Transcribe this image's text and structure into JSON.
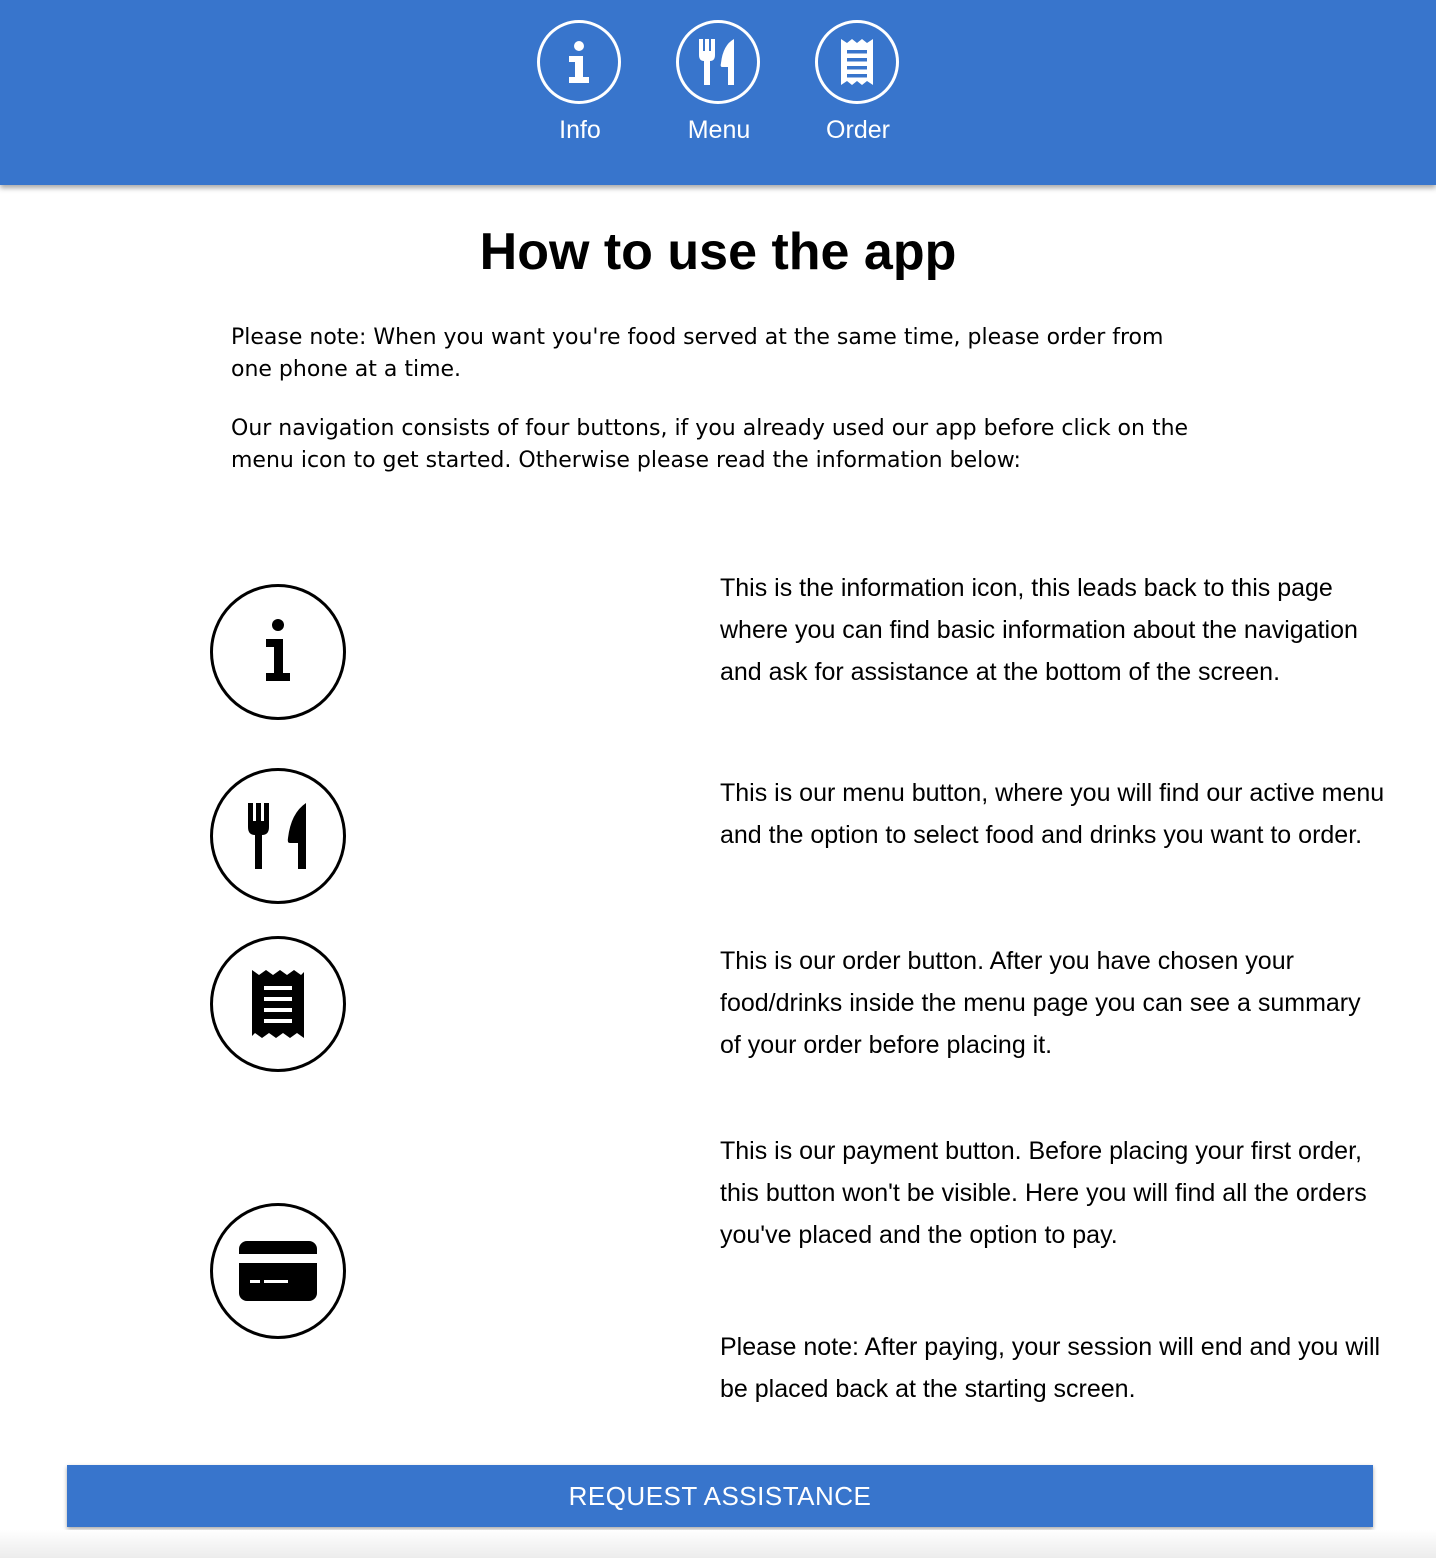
{
  "nav": {
    "items": [
      {
        "label": "Info",
        "icon": "info-icon"
      },
      {
        "label": "Menu",
        "icon": "utensils-icon"
      },
      {
        "label": "Order",
        "icon": "receipt-icon"
      }
    ]
  },
  "main": {
    "title": "How to use the app",
    "note": "Please note: When you want you're food served at the same time, please order from one phone at a time.",
    "intro": "Our navigation consists of four buttons, if you already used our app before click on the menu icon to get started. Otherwise please read the information below:",
    "items": [
      {
        "icon": "info-icon",
        "text": "This is the information icon, this leads back to this page where you can find basic information about the navigation and ask for assistance at the bottom of the screen."
      },
      {
        "icon": "utensils-icon",
        "text": "This is our menu button, where you will find our active menu and the option to select food and drinks you want to order."
      },
      {
        "icon": "receipt-icon",
        "text": "This is our order button. After you have chosen your food/drinks inside the menu page you can see a summary of your order before placing it."
      },
      {
        "icon": "credit-card-icon",
        "text": "This is our payment button. Before placing your first order, this button won't be visible. Here you will find all the orders you've placed and the option to pay."
      }
    ],
    "payment_note": "Please note: After paying, your session will end and you will be placed back at the starting screen."
  },
  "footer": {
    "assist_label": "REQUEST ASSISTANCE"
  },
  "colors": {
    "primary": "#3875cc",
    "text": "#000000",
    "on_primary": "#ffffff"
  }
}
